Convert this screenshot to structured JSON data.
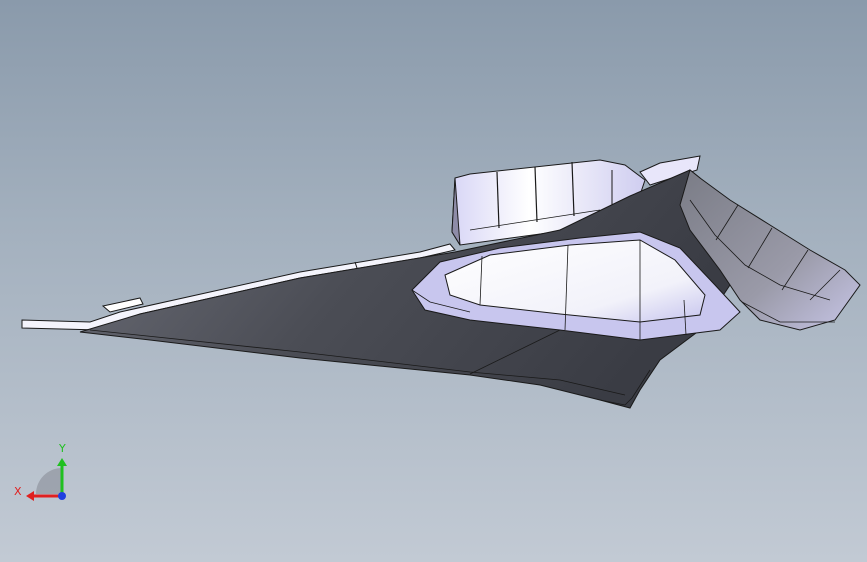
{
  "viewport": {
    "background_top": "#8a9aab",
    "background_bottom": "#c2cad4"
  },
  "model": {
    "description_icon": "cad-part-shaded-with-edges",
    "face_dark": "#4e5058",
    "face_mid": "#8c8e99",
    "face_light": "#ffffff",
    "face_lavender": "#c9c6f0",
    "edge_color": "#1a1a1a"
  },
  "triad": {
    "x_label": "X",
    "y_label": "Y",
    "x_color": "#e02020",
    "y_color": "#20c020",
    "z_color": "#2040e0"
  }
}
